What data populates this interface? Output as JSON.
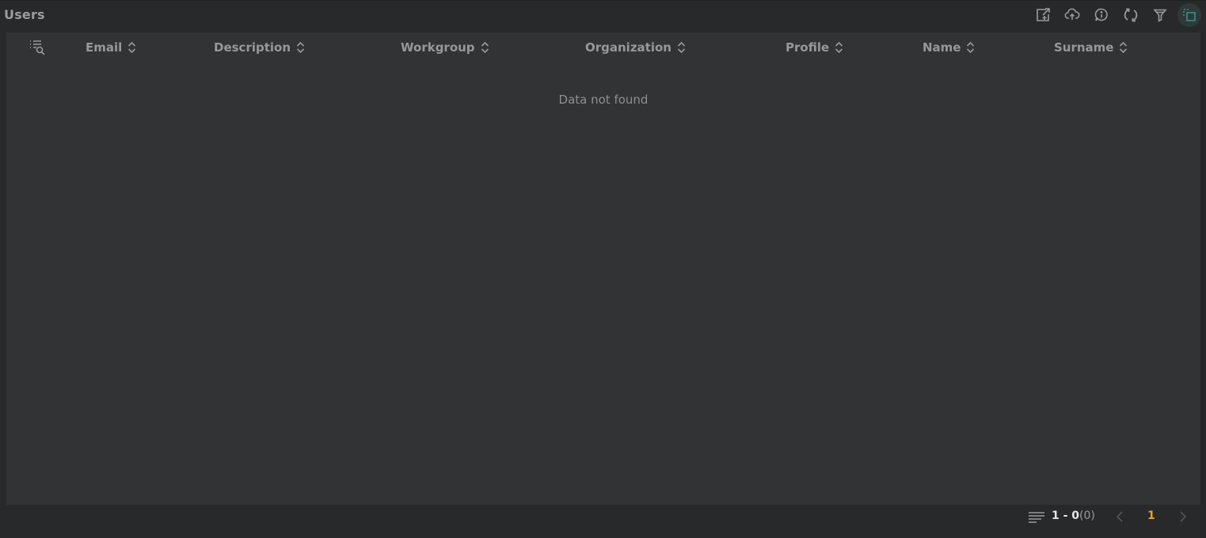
{
  "header": {
    "title": "Users"
  },
  "toolbar": {
    "buttons": [
      {
        "name": "export",
        "icon": "export-icon"
      },
      {
        "name": "upload",
        "icon": "cloud-upload-icon"
      },
      {
        "name": "info",
        "icon": "info-icon"
      },
      {
        "name": "refresh",
        "icon": "refresh-icon"
      },
      {
        "name": "filter",
        "icon": "filter-icon"
      },
      {
        "name": "select-mode",
        "icon": "selection-icon",
        "active": true
      }
    ]
  },
  "table": {
    "columns": [
      {
        "label": "Email"
      },
      {
        "label": "Description"
      },
      {
        "label": "Workgroup"
      },
      {
        "label": "Organization"
      },
      {
        "label": "Profile"
      },
      {
        "label": "Name"
      },
      {
        "label": "Surname"
      }
    ],
    "empty_message": "Data not found"
  },
  "pagination": {
    "range": "1 - 0",
    "total": "(0)",
    "current_page": "1"
  },
  "colors": {
    "background": "#28292b",
    "panel": "#323335",
    "accent_page": "#e9a02a",
    "active_tool": "#3f8a86"
  }
}
